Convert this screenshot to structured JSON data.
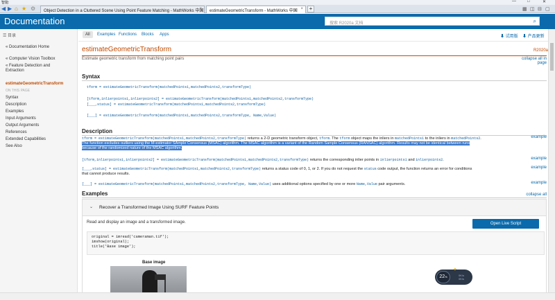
{
  "browser": {
    "title": "智能:",
    "tabs": [
      {
        "label": "Object Detection in a Cluttered Scene Using Point Feature Matching - MathWorks 中国",
        "active": false
      },
      {
        "label": "estimateGeometricTransform - MathWorks 中国",
        "active": true
      }
    ],
    "new_tab": "+"
  },
  "header": {
    "title": "Documentation",
    "search_placeholder": "搜索 R2020a 文档"
  },
  "sidebar": {
    "toc_label": "目录",
    "items": [
      {
        "label": "« Documentation Home"
      },
      {
        "label": "« Computer Vision Toolbox"
      },
      {
        "label": "« Feature Detection and"
      },
      {
        "label": "Extraction"
      },
      {
        "label": "estimateGeometricTransform"
      },
      {
        "label": "ON THIS PAGE"
      },
      {
        "label": "Syntax"
      },
      {
        "label": "Description"
      },
      {
        "label": "Examples"
      },
      {
        "label": "Input Arguments"
      },
      {
        "label": "Output Arguments"
      },
      {
        "label": "References"
      },
      {
        "label": "Extended Capabilities"
      },
      {
        "label": "See Also"
      }
    ]
  },
  "subnav": {
    "items": [
      "All",
      "Examples",
      "Functions",
      "Blocks",
      "Apps"
    ],
    "trial": "试用版",
    "updates": "产品更新"
  },
  "page": {
    "title": "estimateGeometricTransform",
    "release": "R2020a",
    "subtitle": "Estimate geometric transform from matching point pairs",
    "collapse_all_in_page_1": "collapse all in",
    "collapse_all_in_page_2": "page",
    "syntax_heading": "Syntax",
    "syntax": [
      "tform = estimateGeometricTransform(matchedPoints1,matchedPoints2,transformType)",
      "[tform,inlierpoints1,inlierpoints2] = estimateGeometricTransform(matchedPoints1,matchedPoints2,transformType)",
      "[___,status] = estimateGeometricTransform(matchedPoints1,matchedPoints2,transformType)",
      "[___] = estimateGeometricTransform(matchedPoints1,matchedPoints2,transformType, Name,Value)"
    ],
    "description_heading": "Description",
    "desc1_code": "tform = estimateGeometricTransform(matchedPoints1,matchedPoints2,transformType)",
    "desc1_text_a": " returns a 2-D geometric transform object, ",
    "desc1_code2": "tform",
    "desc1_text_b": ". The ",
    "desc1_code3": "tform",
    "desc1_text_c": " object maps the inliers in ",
    "desc1_code4": "matchedPoints1",
    "desc1_text_d": " to the inliers in ",
    "desc1_code5": "matchedPoints2",
    "desc1_text_e": ".",
    "desc1_highlight_1": "The function excludes outliers using the M-estimator SAmple Consensus (MSAC) algorithm. The MSAC algorithm is a variant of the Random Sample Consensus (RANSAC) algorithm. Results may not be identical between runs",
    "desc1_highlight_2": "because of the randomized nature of the MSAC algorithm.",
    "desc2_code": "[tform,inlierpoints1,inlierpoints2] = estimateGeometricTransform(matchedPoints1,matchedPoints2,transformType)",
    "desc2_text": " returns the corresponding inlier points in ",
    "desc2_code2": "inlierpoints1",
    "desc2_text2": " and ",
    "desc2_code3": "inlierpoints2",
    "desc2_text3": ".",
    "desc3_code": "[___,status] = estimateGeometricTransform(matchedPoints1,matchedPoints2,transformType)",
    "desc3_text": " returns a status code of 0, 1, or 2. If you do not request the ",
    "desc3_code2": "status",
    "desc3_text2": " code output, the function returns an error for conditions",
    "desc3_line2": "that cannot produce results.",
    "desc4_code": "[___] = estimateGeometricTransform(matchedPoints1,matchedPoints2,transformType, Name,Value)",
    "desc4_text": " uses additional options specified by one or more ",
    "desc4_code2": "Name,Value",
    "desc4_text2": " pair arguments.",
    "example_link": "example",
    "examples_heading": "Examples",
    "collapse_all": "collapse all",
    "example_title": "Recover a Transformed Image Using SURF Feature Points",
    "example_intro": "Read and display an image and a transformed image.",
    "open_live_script": "Open Live Script",
    "code_lines": [
      "original  = imread('cameraman.tif');",
      "imshow(original);",
      "title('Base image');"
    ],
    "figure_caption": "Base image"
  },
  "widget": {
    "value": "22",
    "unit": "%",
    "line1": "0K/s",
    "line2": "0K/s"
  }
}
